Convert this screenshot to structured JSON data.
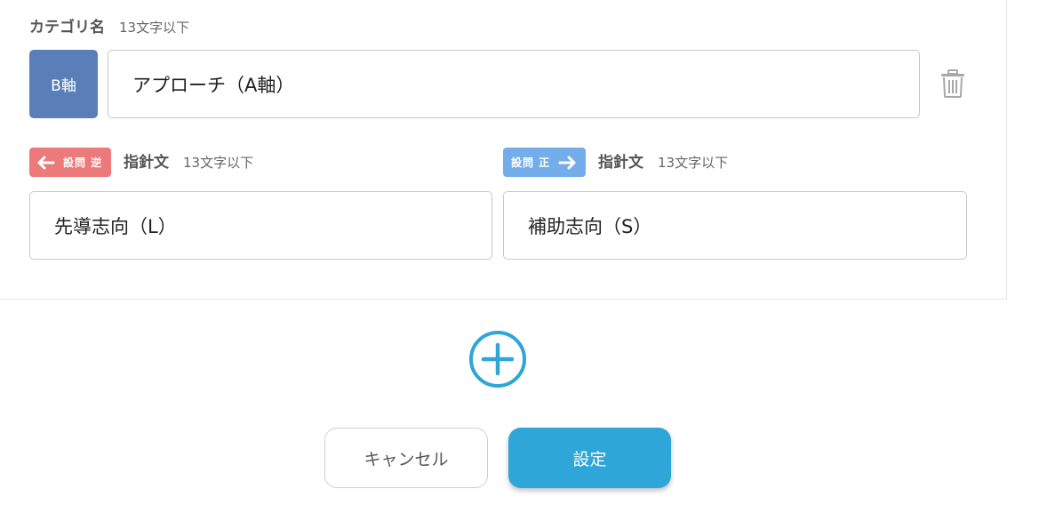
{
  "category": {
    "title": "カテゴリ名",
    "hint": "13文字以下",
    "axis_badge": "B軸",
    "name_value": "アプローチ（A軸）",
    "delete_icon": "trash-icon"
  },
  "guides": {
    "reverse": {
      "badge_text": "設問 逆",
      "badge_color": "#ec7a7a",
      "title": "指針文",
      "hint": "13文字以下",
      "value": "先導志向（L）"
    },
    "forward": {
      "badge_text": "設問 正",
      "badge_color": "#73aeea",
      "title": "指針文",
      "hint": "13文字以下",
      "value": "補助志向（S）"
    }
  },
  "add_button_icon": "plus-circle-icon",
  "actions": {
    "cancel_label": "キャンセル",
    "submit_label": "設定"
  },
  "colors": {
    "axis_badge": "#5a7fb8",
    "primary": "#2ea6d8"
  }
}
